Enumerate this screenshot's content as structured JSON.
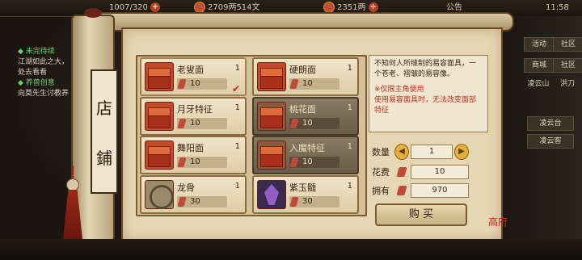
{
  "topbar": {
    "stamina": "1007/320",
    "money": "2709两514文",
    "gold": "2351两",
    "announcement": "公告",
    "time": "11:58"
  },
  "quest": {
    "title1": "◆ 未完待续",
    "text1a": "江湖如此之大，",
    "text1b": "处去看看",
    "title2": "◆ 养兽创意",
    "text2": "向莫先生讨教养"
  },
  "side": {
    "btn1": "活动",
    "btn2": "社区",
    "btn3": "商城",
    "btn4": "社区",
    "loc1": "凌云山",
    "loc2": "洪刀",
    "sub1": "凌云台",
    "sub2": "凌云客"
  },
  "shop": {
    "title_char1": "店",
    "title_char2": "鋪"
  },
  "items": [
    {
      "name": "老叟面",
      "count": "1",
      "price": "10",
      "icon": "treasure-box-icon",
      "selected": true
    },
    {
      "name": "硬朗面",
      "count": "1",
      "price": "10",
      "icon": "treasure-box-icon"
    },
    {
      "name": "月牙特征",
      "count": "1",
      "price": "10",
      "icon": "treasure-box-icon"
    },
    {
      "name": "桃花面",
      "count": "1",
      "price": "10",
      "icon": "treasure-box-icon"
    },
    {
      "name": "舞阳面",
      "count": "1",
      "price": "10",
      "icon": "treasure-box-icon"
    },
    {
      "name": "入魔特征",
      "count": "1",
      "price": "10",
      "icon": "treasure-box-icon"
    },
    {
      "name": "龙骨",
      "count": "1",
      "price": "30",
      "icon": "dragon-bone-icon"
    },
    {
      "name": "紫玉髓",
      "count": "1",
      "price": "30",
      "icon": "purple-crystal-icon"
    }
  ],
  "detail": {
    "desc1": "不知何人所缝制的易容面具，一个苍老、褶皱的易容像。",
    "warn1": "※仅限主角使用",
    "warn2": "使用易容面具时，无法改变面部特征",
    "qty_label": "数量",
    "qty": "1",
    "cost_label": "花费",
    "cost": "10",
    "own_label": "拥有",
    "own": "970",
    "buy": "购 买"
  },
  "stamp": "高府"
}
